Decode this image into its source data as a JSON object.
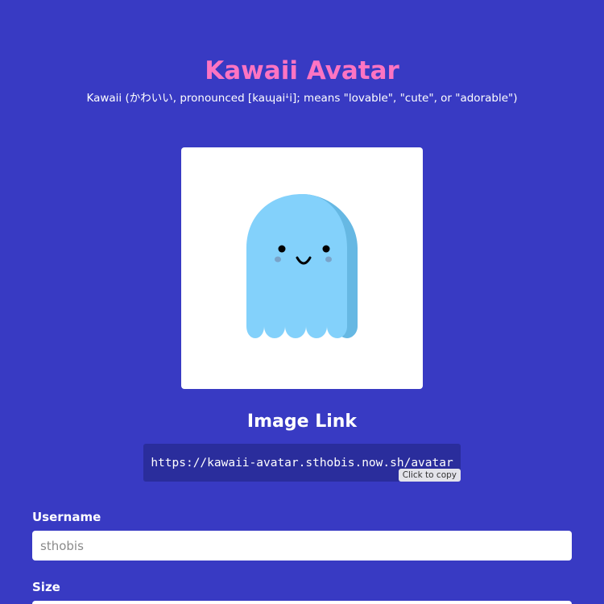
{
  "header": {
    "title": "Kawaii Avatar",
    "subtitle": "Kawaii (かわいい, pronounced [kaɰaiꜜi]; means \"lovable\", \"cute\", or \"adorable\")"
  },
  "avatar": {
    "character": "ghost",
    "body_color": "#83d1fb",
    "shadow_color": "#66b8e3",
    "background": "#ffffff"
  },
  "image_link": {
    "heading": "Image Link",
    "url": "https://kawaii-avatar.sthobis.now.sh/avatar",
    "copy_hint": "Click to copy"
  },
  "form": {
    "username": {
      "label": "Username",
      "placeholder": "sthobis",
      "value": ""
    },
    "size": {
      "label": "Size"
    }
  },
  "colors": {
    "background": "#383ac3",
    "title": "#fd74c2",
    "link_box": "#2a2d9c"
  }
}
